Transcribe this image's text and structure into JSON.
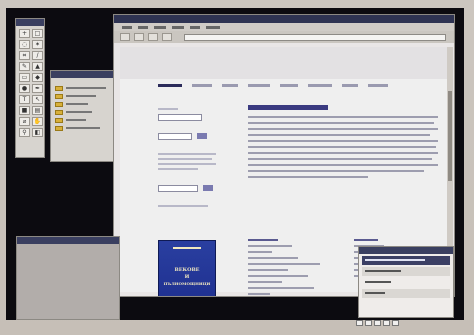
{
  "colors": {
    "desktop": "#0c0b10",
    "bezel": "#c6bfb7",
    "browser_titlebar": "#2e3352",
    "link_blue": "#2a2a70",
    "book_cover": "#2a3fa0"
  },
  "icons": {
    "toolbox": "tool-icons",
    "layer_folder": "folder-icon"
  },
  "book": {
    "title_line1": "ВЕКОВЕ",
    "title_line2": "И",
    "title_line3": "ПЪЛНОМОЩНИЦИ"
  }
}
